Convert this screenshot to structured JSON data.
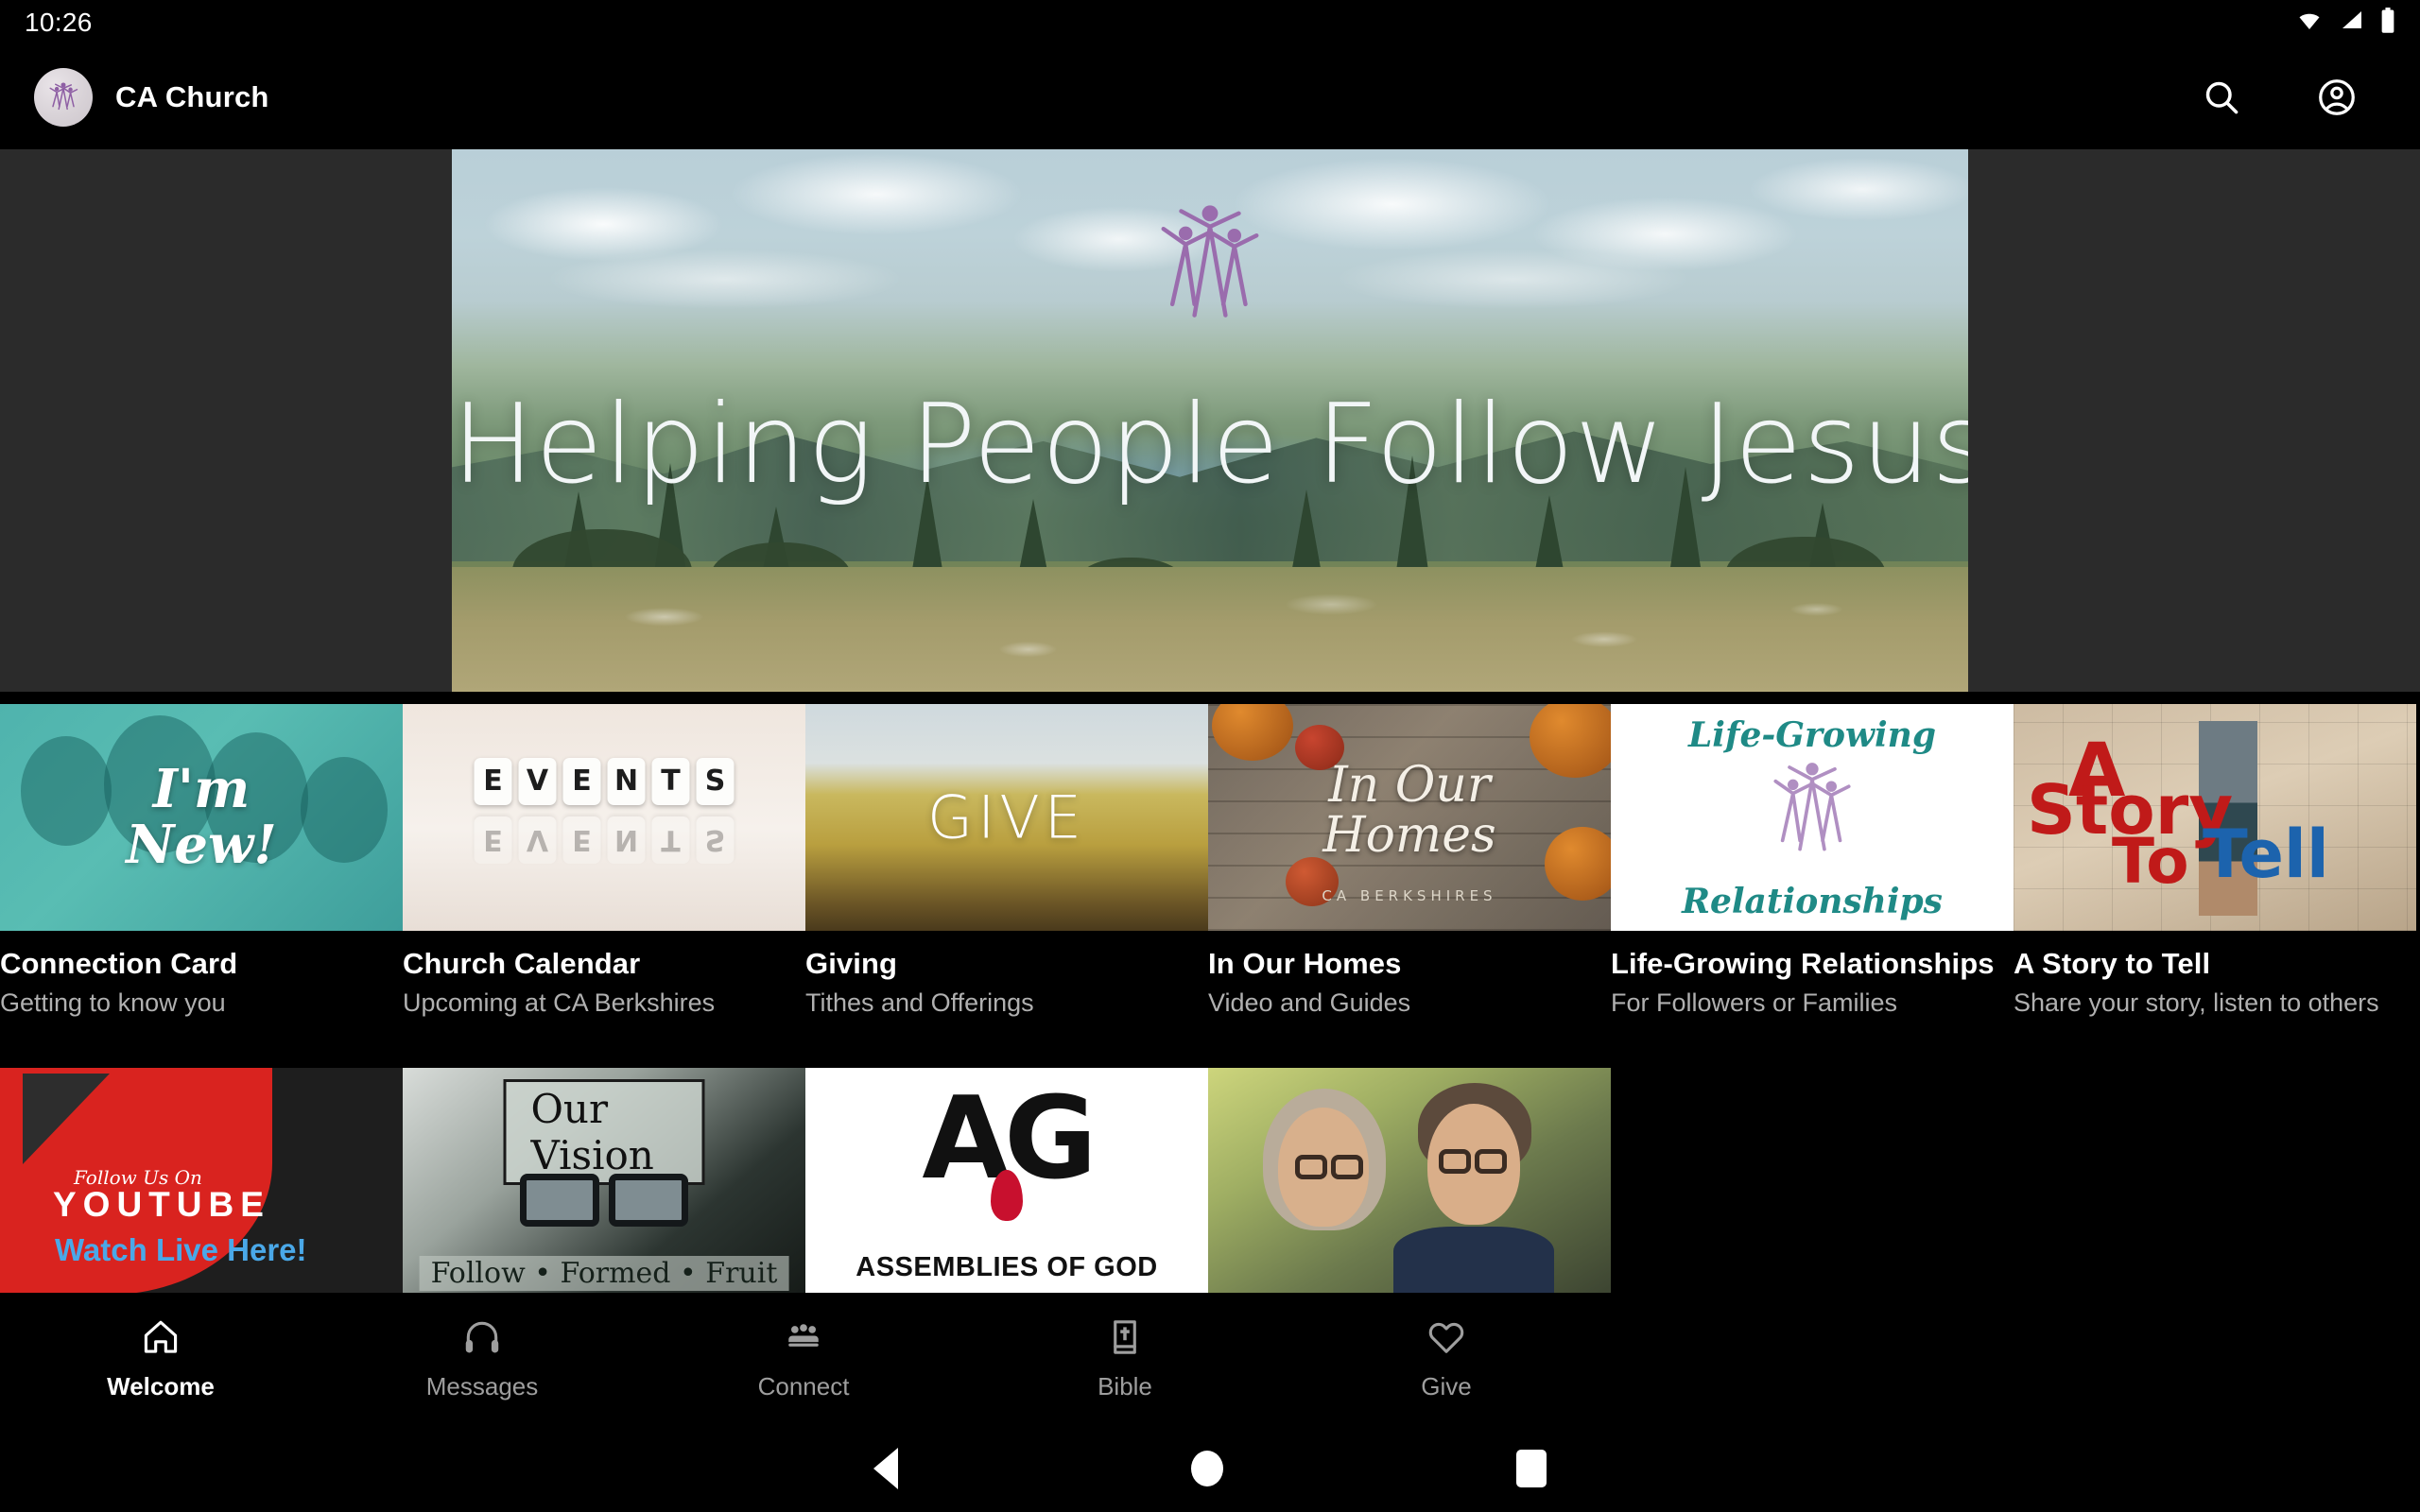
{
  "status_bar": {
    "clock": "10:26",
    "icons": [
      "wifi-icon",
      "cellular-signal-icon",
      "battery-icon"
    ]
  },
  "app_bar": {
    "title": "CA Church",
    "logo_name": "ca-church-logo",
    "actions": [
      {
        "name": "search-icon",
        "label": "Search"
      },
      {
        "name": "account-circle-icon",
        "label": "Account"
      }
    ]
  },
  "hero": {
    "headline": "Helping People Follow Jesus",
    "logo_name": "ca-church-logo-large",
    "image_alt": "Mountain meadow overlooking a lake and valley"
  },
  "cards_row1": [
    {
      "title": "Connection Card",
      "subtitle": "Getting to know you",
      "thumb_caption_line1": "I'm",
      "thumb_caption_line2": "New!"
    },
    {
      "title": "Church Calendar",
      "subtitle": "Upcoming at CA Berkshires",
      "thumb_caption_line1": "EVENTS",
      "thumb_caption_line2": ""
    },
    {
      "title": "Giving",
      "subtitle": "Tithes and Offerings",
      "thumb_caption_line1": "GIVE",
      "thumb_caption_line2": ""
    },
    {
      "title": "In Our Homes",
      "subtitle": "Video and Guides",
      "thumb_caption_line1": "In Our",
      "thumb_caption_line2": "Homes",
      "thumb_caption_line3": "CA BERKSHIRES"
    },
    {
      "title": "Life-Growing Relationships",
      "subtitle": "For Followers or Families",
      "thumb_caption_line1": "Life-Growing",
      "thumb_caption_line2": "Relationships"
    },
    {
      "title": "A Story to Tell",
      "subtitle": "Share your story, listen to others",
      "thumb_caption_line1": "A",
      "thumb_caption_line2": "Story",
      "thumb_caption_line3": "To",
      "thumb_caption_line4": "Tell"
    }
  ],
  "cards_row2": [
    {
      "thumb_caption_line1": "Follow Us On",
      "thumb_caption_line2": "YOUTUBE",
      "thumb_caption_line3": "Watch Live Here!"
    },
    {
      "thumb_caption_line1": "Our Vision",
      "thumb_caption_line2": "Follow • Formed • Fruit"
    },
    {
      "thumb_caption_line1": "AG",
      "thumb_caption_line2": "ASSEMBLIES OF GOD"
    },
    {
      "thumb_caption_line1": "",
      "thumb_caption_line2": ""
    }
  ],
  "bottom_nav": {
    "items": [
      {
        "label": "Welcome",
        "icon": "home-icon",
        "active": true
      },
      {
        "label": "Messages",
        "icon": "headphones-icon",
        "active": false
      },
      {
        "label": "Connect",
        "icon": "group-icon",
        "active": false
      },
      {
        "label": "Bible",
        "icon": "bible-book-icon",
        "active": false
      },
      {
        "label": "Give",
        "icon": "heart-icon",
        "active": false
      }
    ]
  },
  "android_nav": {
    "back": "back-triangle-icon",
    "home": "home-circle-icon",
    "recents": "recents-square-icon"
  },
  "colors": {
    "background": "#000000",
    "hero_backdrop": "#2b2b2b",
    "accent_purple": "#9c6fae",
    "muted_text": "#b0b0b0",
    "active_text": "#ffffff"
  }
}
